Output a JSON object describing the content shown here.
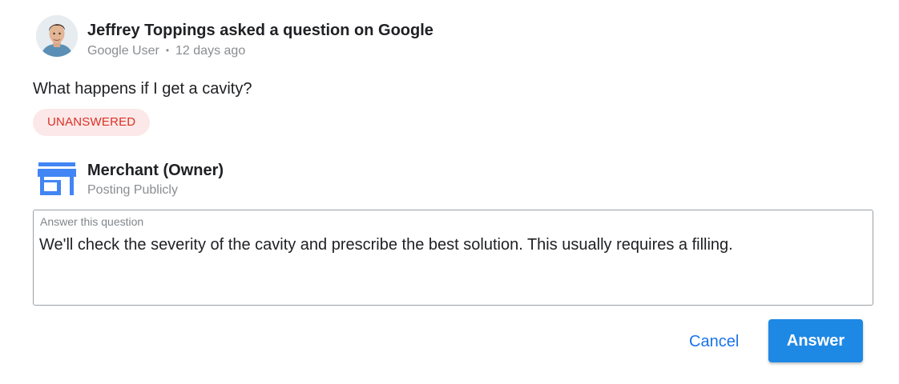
{
  "asker": {
    "title": "Jeffrey Toppings asked a question on Google",
    "role": "Google User",
    "separator": "•",
    "time": "12 days ago"
  },
  "question": {
    "text": "What happens if I get a cavity?",
    "status_badge": "UNANSWERED"
  },
  "merchant": {
    "icon": "store-icon",
    "title": "Merchant (Owner)",
    "subtitle": "Posting Publicly"
  },
  "answer_field": {
    "label": "Answer this question",
    "value": "We'll check the severity of the cavity and prescribe the best solution. This usually requires a filling."
  },
  "actions": {
    "cancel_label": "Cancel",
    "answer_label": "Answer"
  },
  "colors": {
    "accent": "#1e88e5",
    "link": "#1a73e8",
    "badge_bg": "#fce8e8",
    "badge_text": "#d93025",
    "store_icon": "#4285f4"
  }
}
